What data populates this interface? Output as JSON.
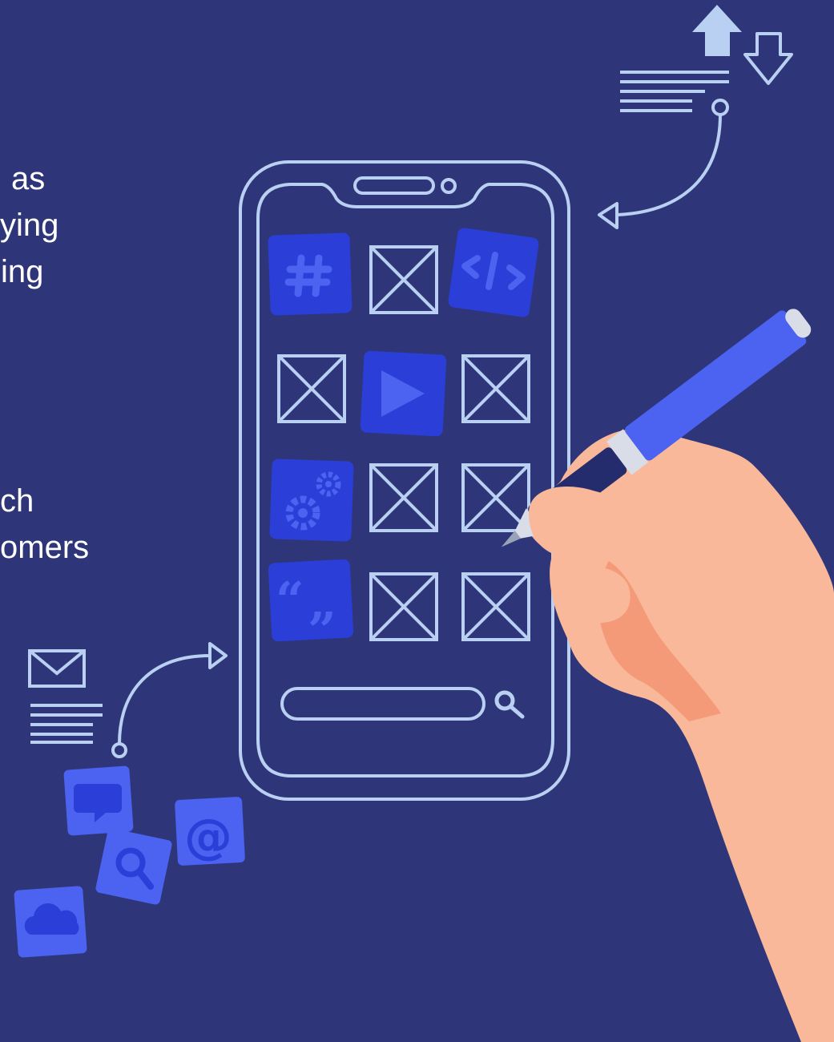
{
  "text_fragments": {
    "top_lines": [
      "as",
      "ying",
      "ing"
    ],
    "bottom_lines": [
      "ch",
      "omers"
    ]
  },
  "colors": {
    "background": "#2e3679",
    "line": "#b9d0f3",
    "tile_dark": "#2b3ed8",
    "tile_light": "#4b63f0",
    "skin": "#f9b899",
    "skin_shadow": "#f49a78",
    "pen_body": "#4b63f0",
    "pen_grip": "#252c6e"
  },
  "icons": [
    "hashtag-icon",
    "code-icon",
    "play-icon",
    "gears-icon",
    "quote-icon",
    "image-placeholder-icon",
    "search-icon",
    "envelope-icon",
    "chat-icon",
    "at-sign-icon",
    "cloud-icon",
    "upload-arrow-icon",
    "download-arrow-icon"
  ]
}
